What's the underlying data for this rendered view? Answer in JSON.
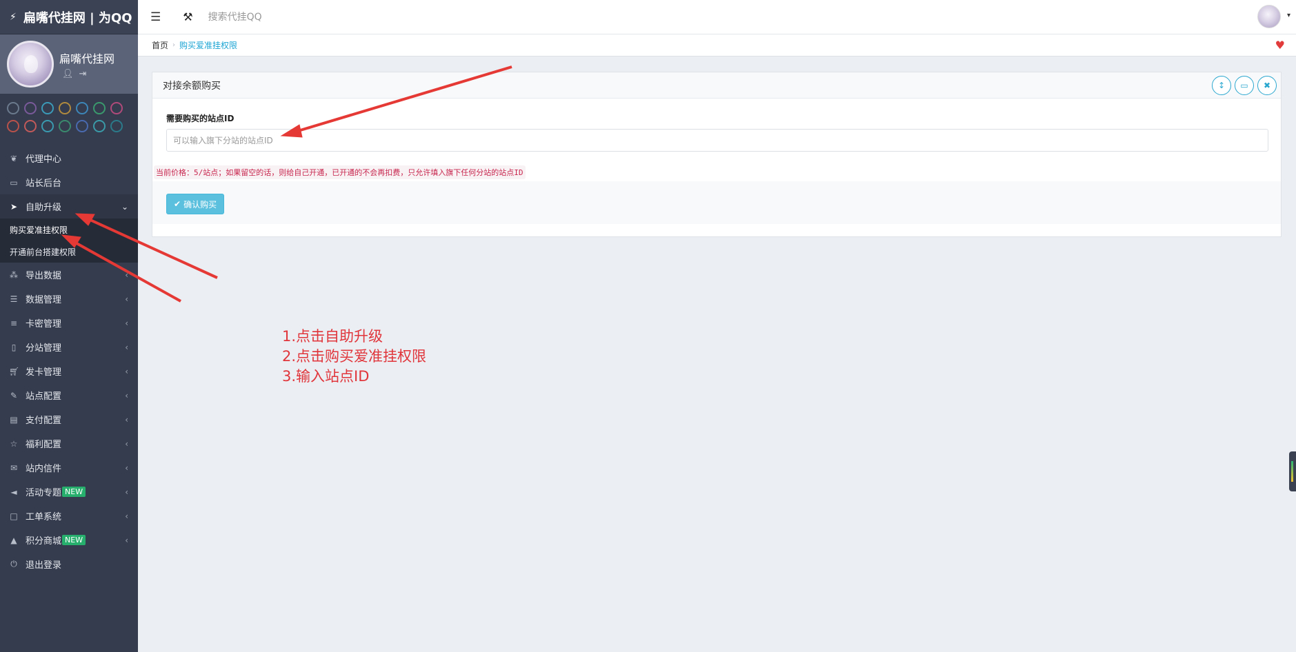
{
  "sidebar": {
    "brand_title": "扁嘴代挂网 | 为QQ",
    "profile_name": "扁嘴代挂网",
    "theme_colors": [
      "#6b7a8d",
      "#7a5a9a",
      "#3b9ab8",
      "#b08a3e",
      "#3c86b8",
      "#3a9a6d",
      "#b04a7a",
      "#b8524a",
      "#c25a5a",
      "#3a9ab0",
      "#3a8a6e",
      "#4a6ab0",
      "#3a9aa8",
      "#2a7a8a"
    ],
    "items": [
      {
        "label": "代理中心",
        "icon": "leaf-icon"
      },
      {
        "label": "站长后台",
        "icon": "laptop-icon"
      },
      {
        "label": "自助升级",
        "icon": "location-arrow-icon"
      },
      {
        "label": "导出数据",
        "icon": "share-nodes-icon"
      },
      {
        "label": "数据管理",
        "icon": "list-icon"
      },
      {
        "label": "卡密管理",
        "icon": "database-icon"
      },
      {
        "label": "分站管理",
        "icon": "tablet-icon"
      },
      {
        "label": "发卡管理",
        "icon": "cart-icon"
      },
      {
        "label": "站点配置",
        "icon": "edit-icon"
      },
      {
        "label": "支付配置",
        "icon": "credit-card-icon"
      },
      {
        "label": "福利配置",
        "icon": "star-half-icon"
      },
      {
        "label": "站内信件",
        "icon": "envelope-icon"
      },
      {
        "label": "活动专题",
        "icon": "bullhorn-icon"
      },
      {
        "label": "工单系统",
        "icon": "file-icon"
      },
      {
        "label": "积分商城",
        "icon": "shopping-bag-icon"
      },
      {
        "label": "退出登录",
        "icon": "power-icon"
      }
    ],
    "sub_items": [
      "购买爱准挂权限",
      "开通前台搭建权限"
    ],
    "badge_new": "NEW"
  },
  "topbar": {
    "search_placeholder": "搜索代挂QQ"
  },
  "breadcrumb": {
    "home": "首页",
    "current": "购买爱准挂权限"
  },
  "panel": {
    "title": "对接余额购买",
    "field_label": "需要购买的站点ID",
    "field_placeholder": "可以输入旗下分站的站点ID",
    "price_hint": "当前价格：5/站点；如果留空的话，则给自己开通，已开通的不会再扣费，只允许填入旗下任何分站的站点ID",
    "confirm_label": "确认购买"
  },
  "annotation": {
    "steps": [
      "1.点击自助升级",
      "2.点击购买爱准挂权限",
      "3.输入站点ID"
    ],
    "color": "#e0353b"
  }
}
